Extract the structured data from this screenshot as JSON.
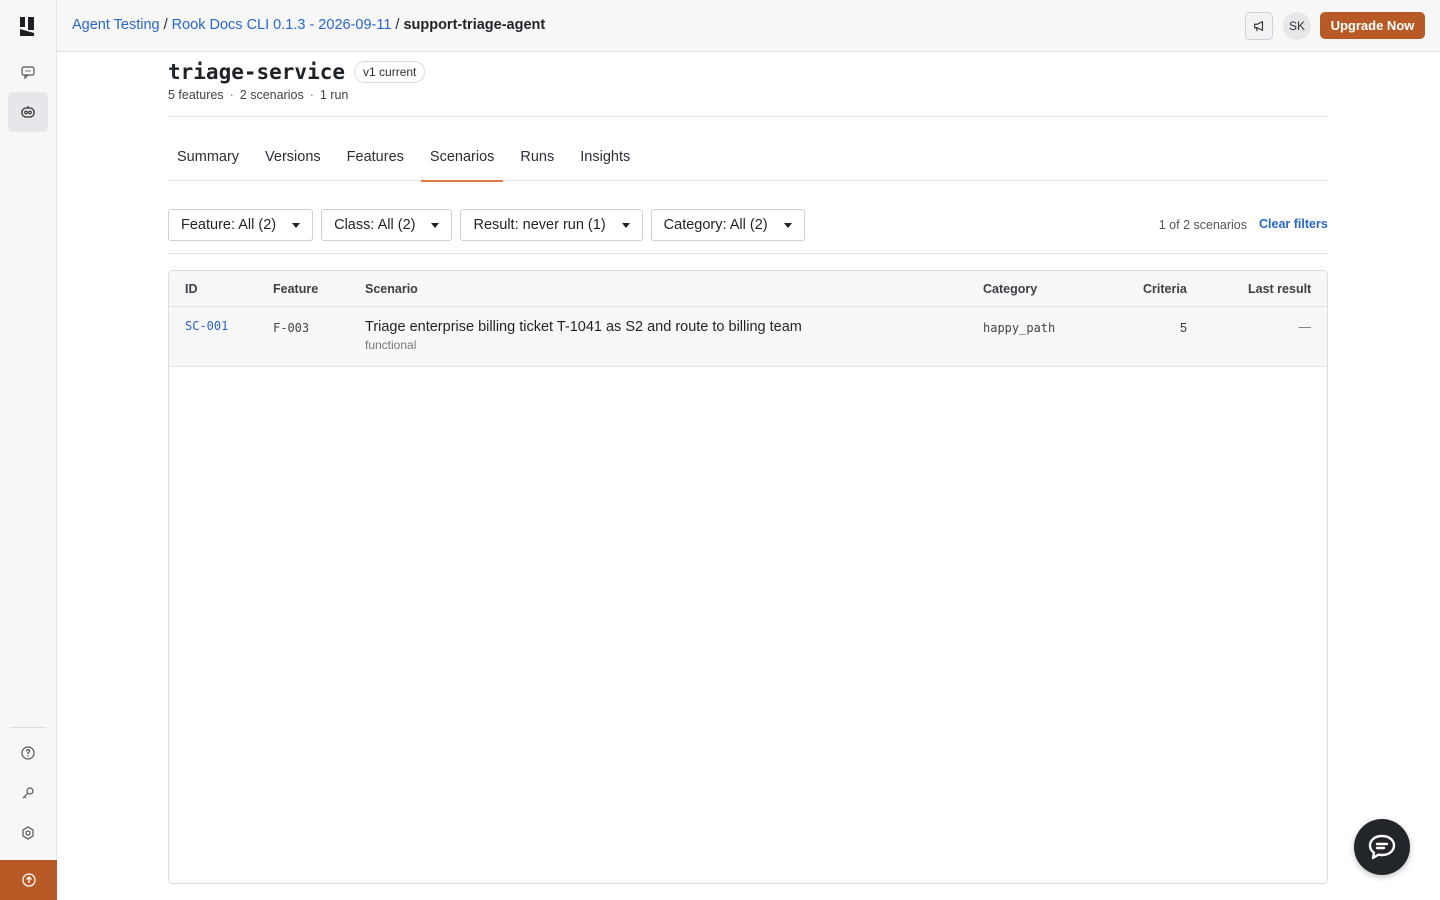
{
  "breadcrumb": {
    "items": [
      "Agent Testing",
      "Rook Docs CLI 0.1.3 - 2026-09-11"
    ],
    "separator": "/",
    "current": "support-triage-agent"
  },
  "topbar": {
    "avatar_initials": "SK",
    "upgrade_label": "Upgrade Now"
  },
  "header": {
    "title": "triage-service",
    "version_badge": "v1 current",
    "stats": [
      "5 features",
      "2 scenarios",
      "1 run"
    ],
    "stats_separator": "·"
  },
  "tabs": [
    {
      "label": "Summary",
      "active": false
    },
    {
      "label": "Versions",
      "active": false
    },
    {
      "label": "Features",
      "active": false
    },
    {
      "label": "Scenarios",
      "active": true
    },
    {
      "label": "Runs",
      "active": false
    },
    {
      "label": "Insights",
      "active": false
    }
  ],
  "filters": [
    {
      "label": "Feature: All (2)"
    },
    {
      "label": "Class: All (2)"
    },
    {
      "label": "Result: never run (1)"
    },
    {
      "label": "Category: All (2)"
    }
  ],
  "result_count": "1 of 2 scenarios",
  "clear_filters_label": "Clear filters",
  "table": {
    "columns": [
      "ID",
      "Feature",
      "Scenario",
      "Category",
      "Criteria",
      "Last result"
    ],
    "rows": [
      {
        "id": "SC-001",
        "feature": "F-003",
        "scenario": "Triage enterprise billing ticket T-1041 as S2 and route to billing team",
        "class": "functional",
        "category": "happy_path",
        "criteria": "5",
        "last_result": "—"
      }
    ]
  },
  "colors": {
    "accent": "#b85a26",
    "link": "#2a66c9",
    "tab_underline": "#e07a43"
  },
  "icons": {
    "sidebar": [
      "logo-icon",
      "chat-icon",
      "agent-icon",
      "help-icon",
      "key-icon",
      "settings-icon",
      "upgrade-icon"
    ],
    "topbar": [
      "megaphone-icon"
    ],
    "fab": "chat-bubble-icon"
  }
}
